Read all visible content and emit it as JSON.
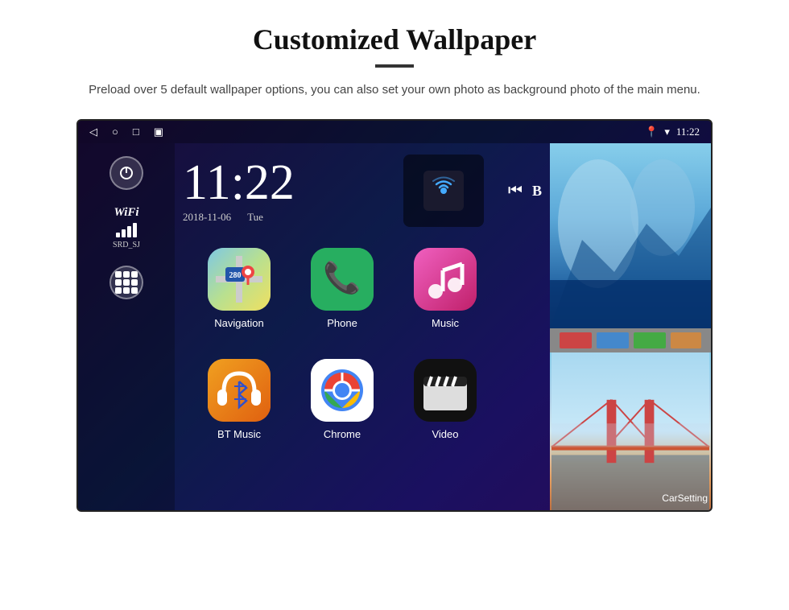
{
  "header": {
    "title": "Customized Wallpaper",
    "subtitle": "Preload over 5 default wallpaper options, you can also set your own photo as background photo of the main menu."
  },
  "statusBar": {
    "time": "11:22",
    "navBack": "◁",
    "navHome": "○",
    "navRecent": "□",
    "navScreenshot": "▣"
  },
  "clock": {
    "time": "11:22",
    "date": "2018-11-06",
    "day": "Tue"
  },
  "wifi": {
    "label": "WiFi",
    "network": "SRD_SJ"
  },
  "apps": [
    {
      "name": "Navigation",
      "type": "navigation"
    },
    {
      "name": "Phone",
      "type": "phone"
    },
    {
      "name": "Music",
      "type": "music"
    },
    {
      "name": "BT Music",
      "type": "btmusic"
    },
    {
      "name": "Chrome",
      "type": "chrome"
    },
    {
      "name": "Video",
      "type": "video"
    }
  ],
  "wallpapers": {
    "label": "CarSetting"
  },
  "colors": {
    "accent": "#4285f4",
    "bg": "#1a0a3a"
  }
}
